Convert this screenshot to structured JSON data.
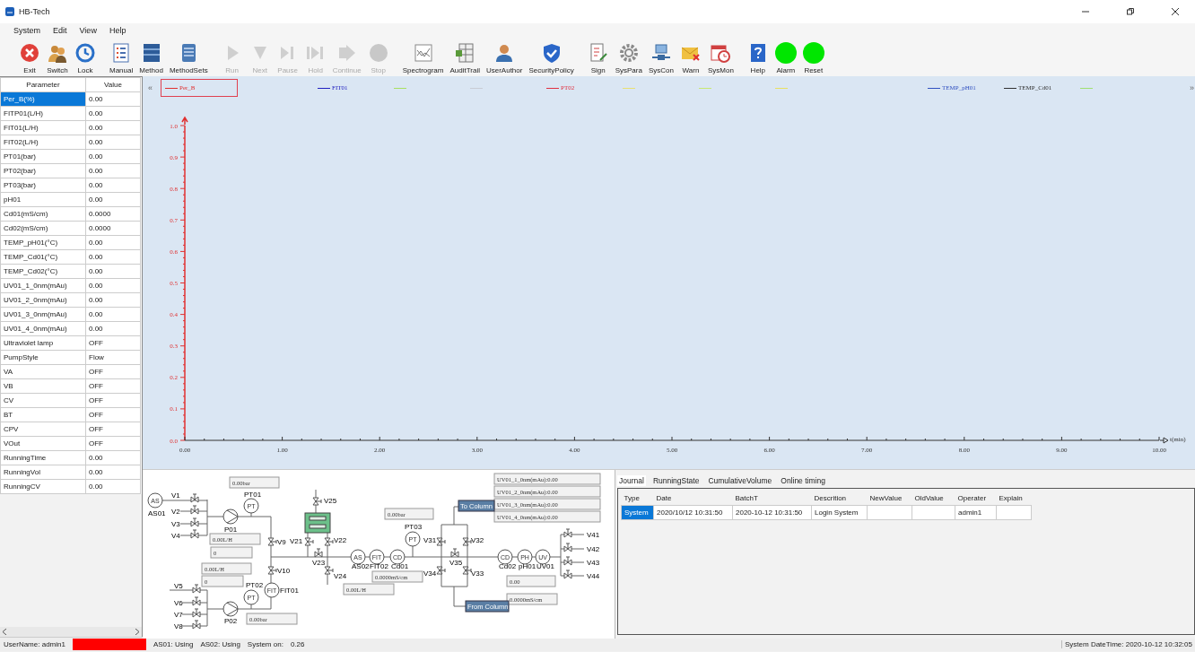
{
  "window": {
    "title": "HB-Tech"
  },
  "menu": [
    "System",
    "Edit",
    "View",
    "Help"
  ],
  "toolbar": [
    {
      "kind": "tool",
      "label": "Exit",
      "disabled": false
    },
    {
      "kind": "tool",
      "label": "Switch",
      "disabled": false
    },
    {
      "kind": "tool",
      "label": "Lock",
      "disabled": false
    },
    {
      "kind": "tool",
      "label": "Manual",
      "disabled": false
    },
    {
      "kind": "tool",
      "label": "Method",
      "disabled": false
    },
    {
      "kind": "tool",
      "label": "MethodSets",
      "disabled": false
    },
    {
      "kind": "tool",
      "label": "Run",
      "disabled": true
    },
    {
      "kind": "tool",
      "label": "Next",
      "disabled": true
    },
    {
      "kind": "tool",
      "label": "Pause",
      "disabled": true
    },
    {
      "kind": "tool",
      "label": "Hold",
      "disabled": true
    },
    {
      "kind": "tool",
      "label": "Continue",
      "disabled": true
    },
    {
      "kind": "tool",
      "label": "Stop",
      "disabled": true
    },
    {
      "kind": "tool",
      "label": "Spectrogram",
      "disabled": false
    },
    {
      "kind": "tool",
      "label": "AuditTrail",
      "disabled": false
    },
    {
      "kind": "tool",
      "label": "UserAuthor",
      "disabled": false
    },
    {
      "kind": "tool",
      "label": "SecurityPolicy",
      "disabled": false
    },
    {
      "kind": "tool",
      "label": "Sign",
      "disabled": false
    },
    {
      "kind": "tool",
      "label": "SysPara",
      "disabled": false
    },
    {
      "kind": "tool",
      "label": "SysCon",
      "disabled": false
    },
    {
      "kind": "tool",
      "label": "Warn",
      "disabled": false
    },
    {
      "kind": "tool",
      "label": "SysMon",
      "disabled": false
    },
    {
      "kind": "tool",
      "label": "Help",
      "disabled": false
    },
    {
      "kind": "indicator",
      "label": "Alarm",
      "color": "#00e600"
    },
    {
      "kind": "indicator",
      "label": "Reset",
      "color": "#00e600"
    }
  ],
  "parameters": {
    "columns": [
      "Parameter",
      "Value"
    ],
    "rows": [
      {
        "name": "Per_B(%)",
        "value": "0.00",
        "selected": true
      },
      {
        "name": "FITP01(L/H)",
        "value": "0.00",
        "selected": false
      },
      {
        "name": "FIT01(L/H)",
        "value": "0.00",
        "selected": false
      },
      {
        "name": "FIT02(L/H)",
        "value": "0.00",
        "selected": false
      },
      {
        "name": "PT01(bar)",
        "value": "0.00",
        "selected": false
      },
      {
        "name": "PT02(bar)",
        "value": "0.00",
        "selected": false
      },
      {
        "name": "PT03(bar)",
        "value": "0.00",
        "selected": false
      },
      {
        "name": "pH01",
        "value": "0.00",
        "selected": false
      },
      {
        "name": "Cd01(mS/cm)",
        "value": "0.0000",
        "selected": false
      },
      {
        "name": "Cd02(mS/cm)",
        "value": "0.0000",
        "selected": false
      },
      {
        "name": "TEMP_pH01(°C)",
        "value": "0.00",
        "selected": false
      },
      {
        "name": "TEMP_Cd01(°C)",
        "value": "0.00",
        "selected": false
      },
      {
        "name": "TEMP_Cd02(°C)",
        "value": "0.00",
        "selected": false
      },
      {
        "name": "UV01_1_0nm(mAu)",
        "value": "0.00",
        "selected": false
      },
      {
        "name": "UV01_2_0nm(mAu)",
        "value": "0.00",
        "selected": false
      },
      {
        "name": "UV01_3_0nm(mAu)",
        "value": "0.00",
        "selected": false
      },
      {
        "name": "UV01_4_0nm(mAu)",
        "value": "0.00",
        "selected": false
      },
      {
        "name": "Ultraviolet lamp",
        "value": "OFF",
        "selected": false
      },
      {
        "name": "PumpStyle",
        "value": "Flow",
        "selected": false
      },
      {
        "name": "VA",
        "value": "OFF",
        "selected": false
      },
      {
        "name": "VB",
        "value": "OFF",
        "selected": false
      },
      {
        "name": "CV",
        "value": "OFF",
        "selected": false
      },
      {
        "name": "BT",
        "value": "OFF",
        "selected": false
      },
      {
        "name": "CPV",
        "value": "OFF",
        "selected": false
      },
      {
        "name": "VOut",
        "value": "OFF",
        "selected": false
      },
      {
        "name": "RunningTime",
        "value": "0.00",
        "selected": false
      },
      {
        "name": "RunningVol",
        "value": "0.00",
        "selected": false
      },
      {
        "name": "RunningCV",
        "value": "0.00",
        "selected": false
      }
    ]
  },
  "chart": {
    "collapse_left": "«",
    "collapse_right": "»",
    "legend": [
      {
        "label": "Per_B",
        "color": "#e03030",
        "selected": true
      },
      {
        "label": "FIT01",
        "color": "#2020c0",
        "selected": false
      },
      {
        "color": "#a8e060",
        "selected": false
      },
      {
        "color": "#c8ccd4",
        "selected": false
      },
      {
        "label": "PT02",
        "color": "#e03040",
        "selected": false
      },
      {
        "color": "#e8e070",
        "selected": false
      },
      {
        "color": "#c8e870",
        "selected": false
      },
      {
        "color": "#e8e060",
        "selected": false
      },
      {
        "label": "TEMP_pH01",
        "color": "#3050c0",
        "selected": false
      },
      {
        "label": "TEMP_Cd01",
        "color": "#303030",
        "selected": false
      },
      {
        "color": "#a0e070",
        "selected": false
      }
    ],
    "chart_data": {
      "type": "line",
      "xlabel": "t(min)",
      "xlim": [
        0,
        10
      ],
      "ylim": [
        0,
        1
      ],
      "xticks": [
        {
          "value": 0,
          "label": "0.00"
        },
        {
          "value": 1,
          "label": "1.00"
        },
        {
          "value": 2,
          "label": "2.00"
        },
        {
          "value": 3,
          "label": "3.00"
        },
        {
          "value": 4,
          "label": "4.00"
        },
        {
          "value": 5,
          "label": "5.00"
        },
        {
          "value": 6,
          "label": "6.00"
        },
        {
          "value": 7,
          "label": "7.00"
        },
        {
          "value": 8,
          "label": "8.00"
        },
        {
          "value": 9,
          "label": "9.00"
        },
        {
          "value": 10,
          "label": "10.00"
        }
      ],
      "yticks": [
        {
          "value": 0,
          "label": "0.0"
        },
        {
          "value": 0.1,
          "label": "0.1"
        },
        {
          "value": 0.2,
          "label": "0.2"
        },
        {
          "value": 0.3,
          "label": "0.3"
        },
        {
          "value": 0.4,
          "label": "0.4"
        },
        {
          "value": 0.5,
          "label": "0.5"
        },
        {
          "value": 0.6,
          "label": "0.6"
        },
        {
          "value": 0.7,
          "label": "0.7"
        },
        {
          "value": 0.8,
          "label": "0.8"
        },
        {
          "value": 0.9,
          "label": "0.9"
        },
        {
          "value": 1,
          "label": "1.0"
        }
      ]
    }
  },
  "diagram": {
    "valves": [
      "V1",
      "V2",
      "V3",
      "V4",
      "V5",
      "V6",
      "V7",
      "V8",
      "V9",
      "V10",
      "V21",
      "V22",
      "V23",
      "V24",
      "V25",
      "V31",
      "V32",
      "V35",
      "V34",
      "V33",
      "V41",
      "V42",
      "V43",
      "V44"
    ],
    "sensors": [
      {
        "symbol": "AS",
        "label": "AS01"
      },
      {
        "symbol": "PT",
        "label": "PT01"
      },
      {
        "symbol": "PT",
        "label": "PT02"
      },
      {
        "symbol": "FIT",
        "label": "FIT01"
      },
      {
        "symbol": "AS",
        "label": "AS02"
      },
      {
        "symbol": "FIT",
        "label": "FIT02"
      },
      {
        "symbol": "CD",
        "label": "Cd01"
      },
      {
        "symbol": "PT",
        "label": "PT03"
      },
      {
        "symbol": "CD",
        "label": "Cd02"
      },
      {
        "symbol": "PH",
        "label": "pH01"
      },
      {
        "symbol": "UV",
        "label": "UV01"
      }
    ],
    "pumps": [
      "P01",
      "P02"
    ],
    "readouts": [
      "0.00bar",
      "UV01_1_0nm(mAu):0.00",
      "UV01_2_0nm(mAu):0.00",
      "UV01_3_0nm(mAu):0.00",
      "UV01_4_0nm(mAu):0.00",
      "0.00bar",
      "0.00L/H",
      "0",
      "0.00L/H",
      "0.0000mS/cm",
      "0",
      "0.00",
      "0.00L/H",
      "0.0000mS/cm",
      "0.00bar"
    ],
    "tags": [
      "To Column",
      "From Column"
    ]
  },
  "tabs": [
    {
      "label": "Journal",
      "selected": true
    },
    {
      "label": "RunningState",
      "selected": false
    },
    {
      "label": "CumulativeVolume",
      "selected": false
    },
    {
      "label": "Online timing",
      "selected": false
    }
  ],
  "journal": {
    "columns": [
      "Type",
      "Date",
      "BatchT",
      "Descrition",
      "NewValue",
      "OldValue",
      "Operater",
      "Explain"
    ],
    "rows": [
      {
        "selected": true,
        "cells": [
          "System",
          "2020/10/12 10:31:50",
          "2020-10-12 10:31:50",
          "Login System",
          "",
          "",
          "admin1",
          ""
        ]
      }
    ]
  },
  "status_bar": {
    "user": "UserName: admin1",
    "alarm": true,
    "as01": "AS01: Using",
    "as02": "AS02: Using",
    "system_on_label": "System on:",
    "system_on_value": "0.26",
    "datetime": "System DateTime: 2020-10-12 10:32:05"
  }
}
